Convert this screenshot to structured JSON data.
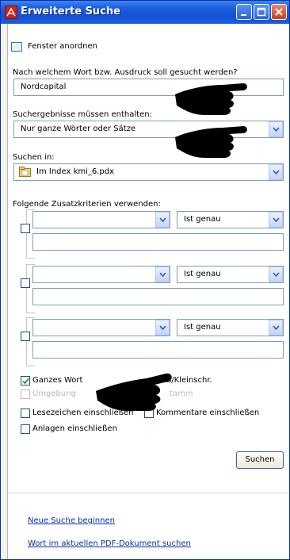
{
  "window": {
    "title": "Erweiterte Suche"
  },
  "arrange_window": {
    "label": "Fenster anordnen"
  },
  "search_term": {
    "question": "Nach welchem Wort bzw. Ausdruck soll gesucht werden?",
    "value": "Nordcapital"
  },
  "results_must_contain": {
    "label": "Suchergebnisse müssen enthalten:",
    "selected": "Nur ganze Wörter oder Sätze"
  },
  "search_in": {
    "label": "Suchen in:",
    "selected": "Im Index kmi_6.pdx"
  },
  "criteria": {
    "label": "Folgende Zusatzkriterien verwenden:",
    "rows": [
      {
        "field_value": "",
        "operator": "Ist genau",
        "text_value": ""
      },
      {
        "field_value": "",
        "operator": "Ist genau",
        "text_value": ""
      },
      {
        "field_value": "",
        "operator": "Ist genau",
        "text_value": ""
      }
    ]
  },
  "options": {
    "whole_word": {
      "label": "Ganzes Wort",
      "checked": true
    },
    "case_sensitive": {
      "label": "ß/Kleinschr."
    },
    "proximity": {
      "label": "Umgebung"
    },
    "stemming": {
      "label": "tamm"
    },
    "include_bookmarks": {
      "label": "Lesezeichen einschließen",
      "checked": false
    },
    "include_comments": {
      "label": "Kommentare einschließen",
      "checked": false
    },
    "include_attachments": {
      "label": "Anlagen einschließen",
      "checked": false
    }
  },
  "search_button": {
    "label": "Suchen"
  },
  "links": {
    "new_search": "Neue Suche beginnen",
    "search_in_current": "Wort im aktuellen PDF-Dokument suchen"
  },
  "colors": {
    "titlebar": "#1f5fe0",
    "link": "#0a2ea8",
    "checkbox_border": "#1c5180"
  },
  "icons": {
    "app": "acrobat-icon",
    "search_in": "pdf-index-icon",
    "dropdown": "chevron-down-icon",
    "pointer": "pointing-hand-icon"
  }
}
